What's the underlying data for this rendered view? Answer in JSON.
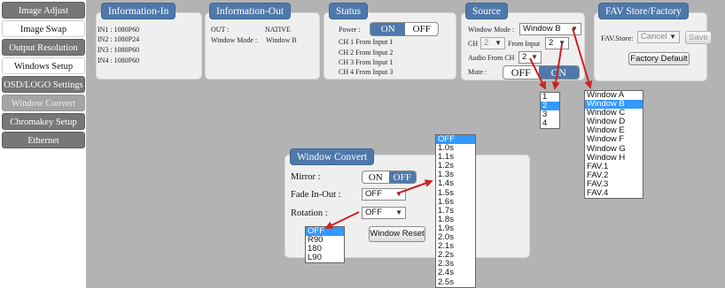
{
  "sidebar": {
    "items": [
      {
        "label": "Image Adjust",
        "state": "normal"
      },
      {
        "label": "Image Swap",
        "state": "active"
      },
      {
        "label": "Output Resolution",
        "state": "normal"
      },
      {
        "label": "Windows Setup",
        "state": "active"
      },
      {
        "label": "OSD/LOGO Settings",
        "state": "normal"
      },
      {
        "label": "Window Convert",
        "state": "disabled"
      },
      {
        "label": "Chromakey Setup",
        "state": "normal"
      },
      {
        "label": "Ethernet",
        "state": "normal"
      }
    ]
  },
  "info_in": {
    "title": "Information-In",
    "lines": [
      "IN1 : 1080P60",
      "IN2 : 1080P24",
      "IN3 : 1080P60",
      "IN4 : 1080P60"
    ]
  },
  "info_out": {
    "title": "Information-Out",
    "out_label": "OUT :",
    "out_value": "NATIVE",
    "mode_label": "Window Mode :",
    "mode_value": "Window B"
  },
  "status": {
    "title": "Status",
    "power_label": "Power :",
    "on": "ON",
    "off": "OFF",
    "lines": [
      "CH 1 From Input   1",
      "CH 2 From Input   2",
      "CH 3 From Input   1",
      "CH 4 From Input   3"
    ]
  },
  "source": {
    "title": "Source",
    "window_mode_label": "Window Mode :",
    "window_mode_value": "Window B",
    "ch_label": "CH",
    "ch_value": "2",
    "from_input_label": "From Input",
    "from_input_value": "2",
    "audio_label": "Audio From CH",
    "audio_value": "2",
    "mute_label": "Mute :",
    "mute_off": "OFF",
    "mute_on": "ON"
  },
  "fav": {
    "title": "FAV Store/Factory",
    "store_label": "FAV.Store:",
    "store_value": "Cancel",
    "save": "Save",
    "factory_default": "Factory Default"
  },
  "window_convert": {
    "title": "Window Convert",
    "mirror_label": "Mirror :",
    "on": "ON",
    "off": "OFF",
    "fade_label": "Fade In-Out :",
    "fade_value": "OFF",
    "rotation_label": "Rotation :",
    "rotation_value": "OFF",
    "reset": "Window Reset"
  },
  "dropdowns": {
    "audio_options": [
      "1",
      "2",
      "3",
      "4"
    ],
    "audio_selected": "2",
    "window_mode_options": [
      "Window A",
      "Window B",
      "Window C",
      "Window D",
      "Window E",
      "Window F",
      "Window G",
      "Window H",
      "FAV.1",
      "FAV.2",
      "FAV.3",
      "FAV.4"
    ],
    "window_mode_selected": "Window B",
    "fade_options": [
      "OFF",
      "1.0s",
      "1.1s",
      "1.2s",
      "1.3s",
      "1.4s",
      "1.5s",
      "1.6s",
      "1.7s",
      "1.8s",
      "1.9s",
      "2.0s",
      "2.1s",
      "2.2s",
      "2.3s",
      "2.4s",
      "2.5s"
    ],
    "fade_selected": "OFF",
    "rotation_options": [
      "OFF",
      "R90",
      "180",
      "L90"
    ],
    "rotation_selected": "OFF"
  },
  "colors": {
    "accent": "#4f78aa",
    "highlight": "#3399ff",
    "arrow": "#cc2222",
    "background": "#b3b3b3"
  }
}
